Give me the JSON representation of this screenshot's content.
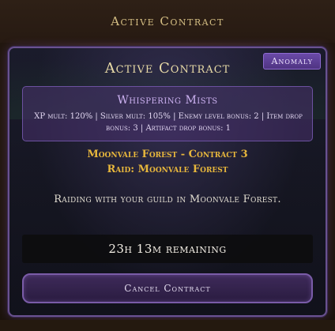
{
  "header": {
    "title": "Active Contract"
  },
  "panel": {
    "title": "Active Contract",
    "badge": "Anomaly",
    "modifier": {
      "name": "Whispering Mists",
      "stats": "XP mult: 120% | Silver mult: 105% | Enemy level bonus: 2 | Item drop bonus: 3 | Artifact drop bonus: 1"
    },
    "contract_name": "Moonvale Forest - Contract 3",
    "raid_name": "Raid: Moonvale Forest",
    "description": "Raiding with your guild in Moonvale Forest.",
    "timer": "23h 13m remaining",
    "cancel_label": "Cancel Contract"
  },
  "colors": {
    "accent_purple": "#6a4aa8",
    "gold_text": "#e8b73c",
    "title_text": "#e7d9a6"
  }
}
